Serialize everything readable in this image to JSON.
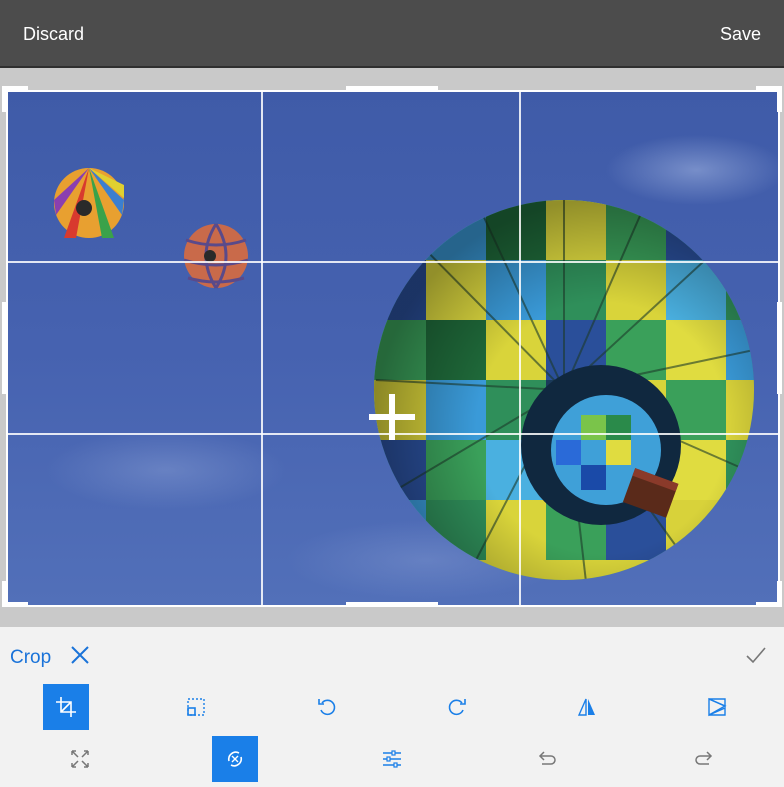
{
  "topbar": {
    "discard_label": "Discard",
    "save_label": "Save"
  },
  "panel": {
    "mode_label": "Crop"
  },
  "icons": {
    "close": "close-icon",
    "apply": "checkmark-icon",
    "crop": "crop-icon",
    "aspect": "aspect-ratio-icon",
    "rotate_left": "rotate-left-icon",
    "rotate_right": "rotate-right-icon",
    "flip_horizontal": "flip-horizontal-icon",
    "flip_vertical": "flip-vertical-icon",
    "expand": "expand-icon",
    "straighten": "straighten-icon",
    "adjust": "sliders-icon",
    "undo": "undo-icon",
    "redo": "redo-icon"
  },
  "colors": {
    "accent": "#1a7fe8",
    "topbar": "#4c4c4c",
    "sky": "#4662b0"
  }
}
